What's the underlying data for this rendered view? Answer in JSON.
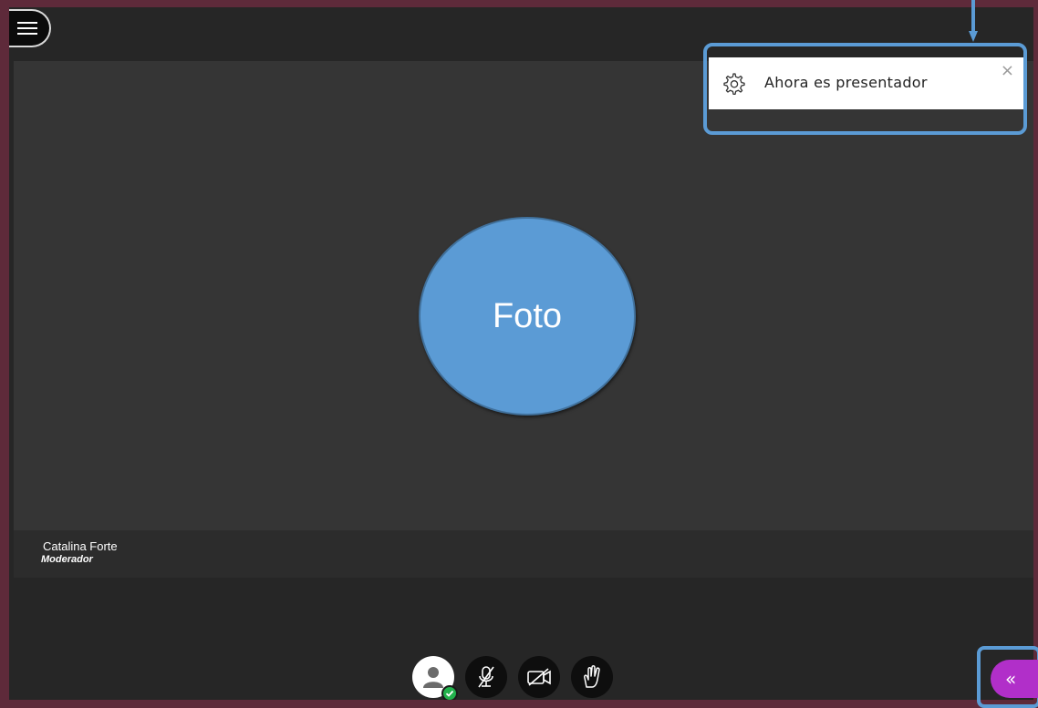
{
  "menu": {
    "icon": "hamburger-menu-icon"
  },
  "stage": {
    "avatar_label": "Foto",
    "participant_name": "Catalina Forte",
    "participant_role": "Moderador"
  },
  "notification": {
    "icon": "gear-icon",
    "message": "Ahora es presentador",
    "close_label": "×"
  },
  "toolbar": {
    "buttons": [
      {
        "icon": "user-status-icon",
        "status": "active"
      },
      {
        "icon": "mic-muted-icon"
      },
      {
        "icon": "camera-off-icon"
      },
      {
        "icon": "raise-hand-icon"
      }
    ]
  },
  "sidebar_toggle": {
    "label": "«"
  },
  "colors": {
    "accent": "#5b9bd5",
    "sidebar_toggle": "#b12fc9",
    "status_ok": "#22b14c",
    "frame": "#5e2a3a"
  }
}
